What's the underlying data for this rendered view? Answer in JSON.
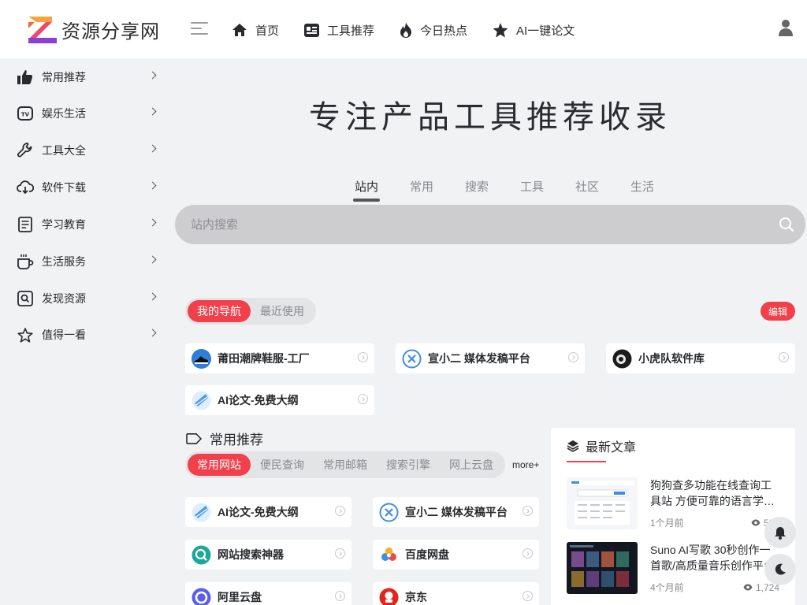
{
  "header": {
    "logo_text": "资源分享网",
    "nav": [
      {
        "label": "首页",
        "icon": "home-icon"
      },
      {
        "label": "工具推荐",
        "icon": "window-icon"
      },
      {
        "label": "今日热点",
        "icon": "fire-icon"
      },
      {
        "label": "AI一键论文",
        "icon": "star-icon"
      }
    ]
  },
  "sidebar": {
    "items": [
      {
        "label": "常用推荐",
        "icon": "thumbs-up-icon"
      },
      {
        "label": "娱乐生活",
        "icon": "tv-icon"
      },
      {
        "label": "工具大全",
        "icon": "wrench-icon"
      },
      {
        "label": "软件下载",
        "icon": "cloud-download-icon"
      },
      {
        "label": "学习教育",
        "icon": "document-icon"
      },
      {
        "label": "生活服务",
        "icon": "coffee-cup-icon"
      },
      {
        "label": "发现资源",
        "icon": "search-box-icon"
      },
      {
        "label": "值得一看",
        "icon": "star-outline-icon"
      }
    ]
  },
  "hero": {
    "title": "专注产品工具推荐收录"
  },
  "search": {
    "tabs": [
      "站内",
      "常用",
      "搜索",
      "工具",
      "社区",
      "生活"
    ],
    "active_tab": "站内",
    "placeholder": "站内搜索"
  },
  "my_nav": {
    "tabs": [
      "我的导航",
      "最近使用"
    ],
    "edit_label": "编辑",
    "cards": [
      "莆田潮牌鞋服-工厂",
      "宣小二 媒体发稿平台",
      "小虎队软件库",
      "AI论文-免费大纲"
    ]
  },
  "common": {
    "title": "常用推荐",
    "tabs": [
      "常用网站",
      "便民查询",
      "常用邮箱",
      "搜索引擎",
      "网上云盘"
    ],
    "more_label": "more+",
    "cards": [
      "AI论文-免费大纲",
      "宣小二 媒体发稿平台",
      "网站搜索神器",
      "百度网盘",
      "阿里云盘",
      "京东"
    ]
  },
  "articles": {
    "title": "最新文章",
    "items": [
      {
        "title": "狗狗查多功能在线查询工具站 方便可靠的语言学…",
        "time": "1个月前",
        "views": "526"
      },
      {
        "title": "Suno AI写歌 30秒创作一首歌/高质量音乐创作平台",
        "time": "4个月前",
        "views": "1,724"
      }
    ]
  },
  "colors": {
    "accent": "#f1404b",
    "background": "#f1f2f3"
  }
}
